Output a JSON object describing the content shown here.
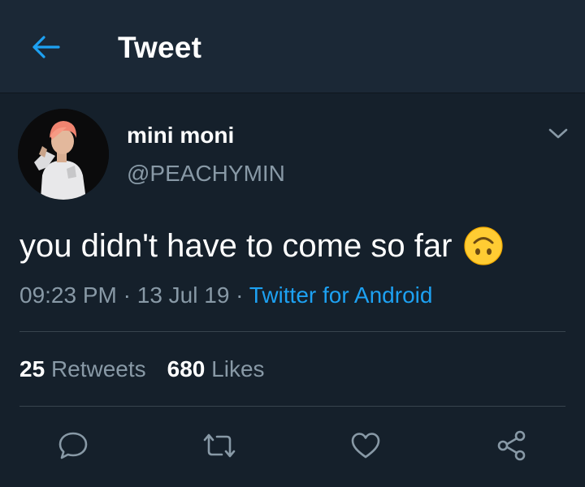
{
  "header": {
    "title": "Tweet"
  },
  "tweet": {
    "display_name": "mini moni",
    "handle": "@PEACHYMIN",
    "text": "you didn't have to come so far",
    "emoji": "upside-down-face",
    "time": "09:23 PM",
    "date": "13 Jul 19",
    "separator": "·",
    "source": "Twitter for Android"
  },
  "stats": {
    "retweets_count": "25",
    "retweets_label": "Retweets",
    "likes_count": "680",
    "likes_label": "Likes"
  },
  "actions": [
    "reply-icon",
    "retweet-icon",
    "like-icon",
    "share-icon"
  ],
  "colors": {
    "background": "#15202b",
    "header": "#1b2836",
    "accent": "#1da1f2",
    "secondary_text": "#8899a6",
    "divider": "#38444d"
  }
}
